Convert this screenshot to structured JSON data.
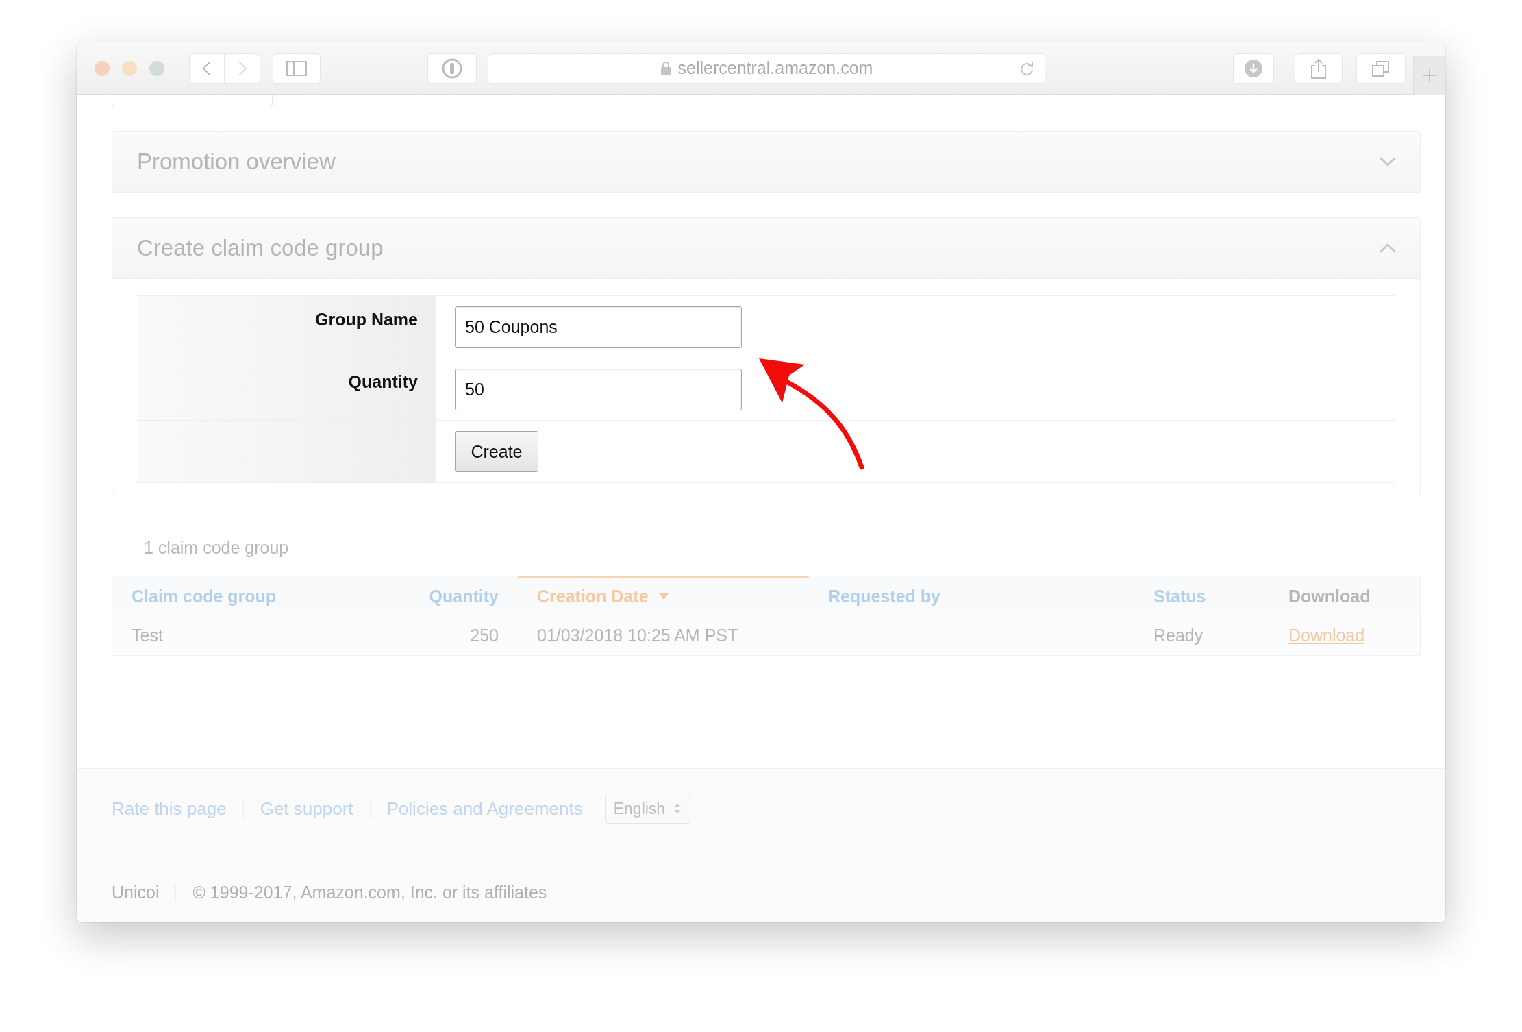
{
  "browser": {
    "url": "sellercentral.amazon.com"
  },
  "panels": [
    {
      "title": "Promotion overview",
      "expanded": false
    },
    {
      "title": "Create claim code group",
      "expanded": true,
      "form": {
        "fields": [
          {
            "label": "Group Name",
            "value": "50 Coupons"
          },
          {
            "label": "Quantity",
            "value": "50"
          }
        ],
        "submit": "Create"
      }
    }
  ],
  "summary": "1 claim code group",
  "table": {
    "columns": [
      {
        "label": "Claim code group",
        "sortable": true,
        "sorted": false
      },
      {
        "label": "Quantity",
        "sortable": true,
        "sorted": false
      },
      {
        "label": "Creation Date",
        "sortable": true,
        "sorted": true
      },
      {
        "label": "Requested by",
        "sortable": true,
        "sorted": false
      },
      {
        "label": "Status",
        "sortable": true,
        "sorted": false
      },
      {
        "label": "Download",
        "sortable": false,
        "sorted": false
      }
    ],
    "rows": [
      {
        "claim_code_group": "Test",
        "quantity": "250",
        "creation_date": "01/03/2018 10:25 AM PST",
        "status": "Ready",
        "download": "Download"
      }
    ]
  },
  "footer": {
    "links": [
      "Rate this page",
      "Get support",
      "Policies and Agreements"
    ],
    "language": "English",
    "brand": "Unicoi",
    "copyright": "© 1999-2017, Amazon.com, Inc. or its affiliates"
  }
}
